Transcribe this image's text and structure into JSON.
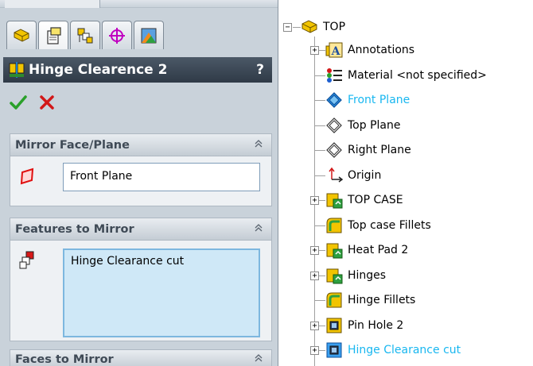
{
  "property_manager": {
    "tabs": [
      {
        "name": "featuremanager-tab",
        "icon": "feature-tree-icon"
      },
      {
        "name": "propertymanager-tab",
        "icon": "property-sheet-icon"
      },
      {
        "name": "configurationmanager-tab",
        "icon": "configuration-icon"
      },
      {
        "name": "dimxpert-tab",
        "icon": "crosshair-icon"
      },
      {
        "name": "displaymanager-tab",
        "icon": "appearance-icon"
      }
    ],
    "title": "Hinge Clearence 2",
    "help_label": "?",
    "groups": {
      "mirror_face_plane": {
        "title": "Mirror Face/Plane",
        "value": "Front Plane"
      },
      "features_to_mirror": {
        "title": "Features to Mirror",
        "items": [
          "Hinge Clearance cut"
        ]
      },
      "faces_to_mirror": {
        "title": "Faces to Mirror"
      }
    }
  },
  "tree": {
    "root": "TOP",
    "items": [
      {
        "label": "Annotations",
        "icon": "annotations-icon",
        "expandable": true,
        "highlight": false
      },
      {
        "label": "Material <not specified>",
        "icon": "material-icon",
        "expandable": false,
        "highlight": false
      },
      {
        "label": "Front Plane",
        "icon": "plane-icon",
        "expandable": false,
        "highlight": true
      },
      {
        "label": "Top Plane",
        "icon": "plane-icon",
        "expandable": false,
        "highlight": false
      },
      {
        "label": "Right Plane",
        "icon": "plane-icon",
        "expandable": false,
        "highlight": false
      },
      {
        "label": "Origin",
        "icon": "origin-icon",
        "expandable": false,
        "highlight": false
      },
      {
        "label": "TOP CASE",
        "icon": "feature-icon",
        "expandable": true,
        "highlight": false
      },
      {
        "label": "Top case Fillets",
        "icon": "fillet-icon",
        "expandable": false,
        "highlight": false
      },
      {
        "label": "Heat Pad 2",
        "icon": "feature-icon",
        "expandable": true,
        "highlight": false
      },
      {
        "label": "Hinges",
        "icon": "feature-icon",
        "expandable": true,
        "highlight": false
      },
      {
        "label": "Hinge Fillets",
        "icon": "fillet-icon",
        "expandable": false,
        "highlight": false
      },
      {
        "label": "Pin Hole 2",
        "icon": "cut-icon",
        "expandable": true,
        "highlight": false
      },
      {
        "label": "Hinge Clearance cut",
        "icon": "cut-icon",
        "expandable": true,
        "highlight": true
      }
    ]
  },
  "colors": {
    "highlight_text": "#18b7f0",
    "title_bar": "#2f3a47",
    "panel_bg": "#c9d2da"
  }
}
